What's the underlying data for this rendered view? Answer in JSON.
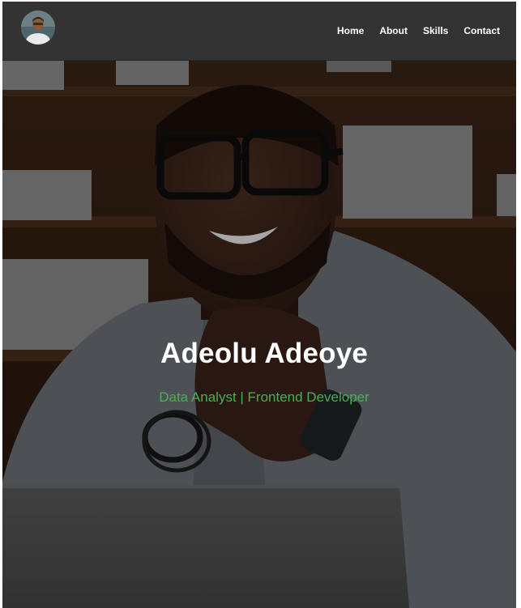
{
  "nav": {
    "items": [
      {
        "label": "Home"
      },
      {
        "label": "About"
      },
      {
        "label": "Skills"
      },
      {
        "label": "Contact"
      }
    ]
  },
  "hero": {
    "name": "Adeolu Adeoye",
    "tagline": "Data Analyst | Frontend Developer"
  },
  "colors": {
    "navbar": "#333333",
    "accent": "#4caf50",
    "text": "#ffffff"
  }
}
